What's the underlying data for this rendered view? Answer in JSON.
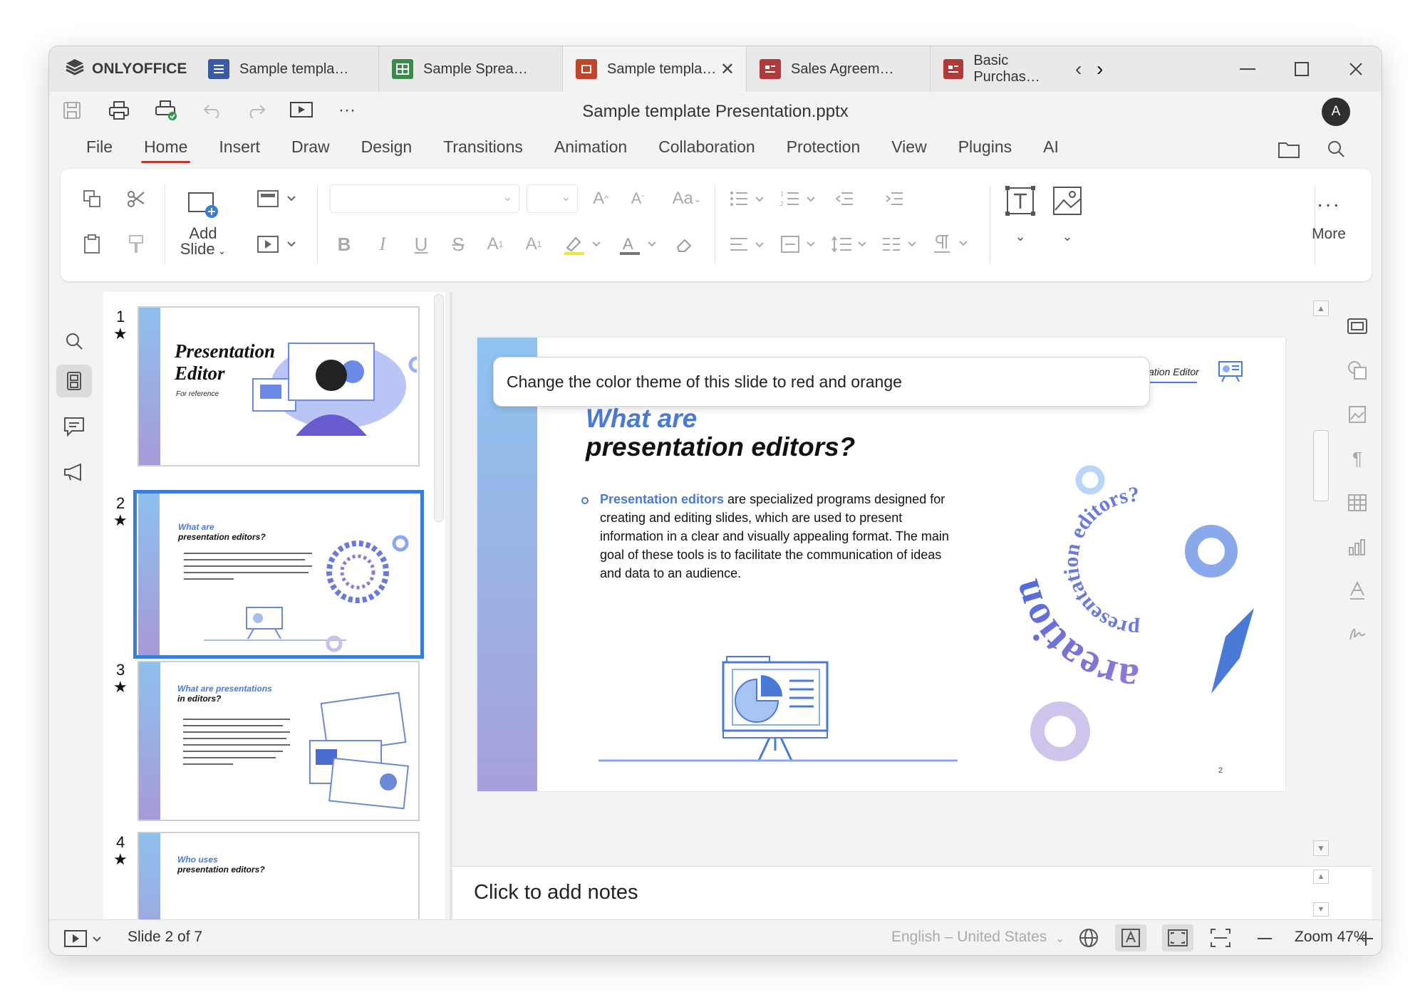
{
  "app": {
    "brand": "ONLYOFFICE"
  },
  "tabs": [
    {
      "label": "Sample templa…",
      "icon": "document-icon",
      "color": "#3b5aa5"
    },
    {
      "label": "Sample Sprea…",
      "icon": "spreadsheet-icon",
      "color": "#3a8a4a"
    },
    {
      "label": "Sample templa…",
      "icon": "presentation-icon",
      "color": "#c0452a",
      "active": true
    },
    {
      "label": "Sales Agreem…",
      "icon": "form-icon",
      "color": "#b03a3a"
    },
    {
      "label": "Basic Purchas…",
      "icon": "form-icon",
      "color": "#b03a3a"
    }
  ],
  "document": {
    "title": "Sample template Presentation.pptx"
  },
  "user": {
    "avatar_letter": "A"
  },
  "menu": [
    "File",
    "Home",
    "Insert",
    "Draw",
    "Design",
    "Transitions",
    "Animation",
    "Collaboration",
    "Protection",
    "View",
    "Plugins",
    "AI"
  ],
  "ribbon": {
    "add_slide_line1": "Add",
    "add_slide_line2": "Slide",
    "more_label": "More"
  },
  "thumbnails": [
    {
      "number": "1",
      "title_line1": "Presentation",
      "title_line2": "Editor",
      "subtitle": "For reference"
    },
    {
      "number": "2",
      "title_line1": "What are",
      "title_line2": "presentation editors?"
    },
    {
      "number": "3",
      "title_line1": "What are presentations",
      "title_line2": "in editors?"
    },
    {
      "number": "4",
      "title_line1": "Who uses",
      "title_line2": "presentation editors?"
    }
  ],
  "slide": {
    "heading_line1": "What are",
    "heading_line2": "presentation editors?",
    "header_label": "ation Editor",
    "bullet_highlight": "Presentation editors",
    "bullet_line1": " are specialized programs designed for",
    "bullet_line2": "creating and editing slides, which are used to present",
    "bullet_line3": "information in a clear and visually appealing format. The main",
    "bullet_line4": "goal of these tools is to facilitate the communication of ideas",
    "bullet_line5": "and data to an audience.",
    "page_number": "2",
    "spiral_text_outer": "areation",
    "spiral_text_inner": "presentation editors?"
  },
  "prompt": {
    "text": "Change the color theme of this slide to red and orange"
  },
  "notes": {
    "placeholder": "Click to add notes"
  },
  "status": {
    "slide_indicator": "Slide 2 of 7",
    "language": "English – United States",
    "zoom": "Zoom 47%"
  },
  "colors": {
    "accent": "#c0392b",
    "selection": "#3a7be0",
    "slide_blue": "#4a7ad8"
  }
}
